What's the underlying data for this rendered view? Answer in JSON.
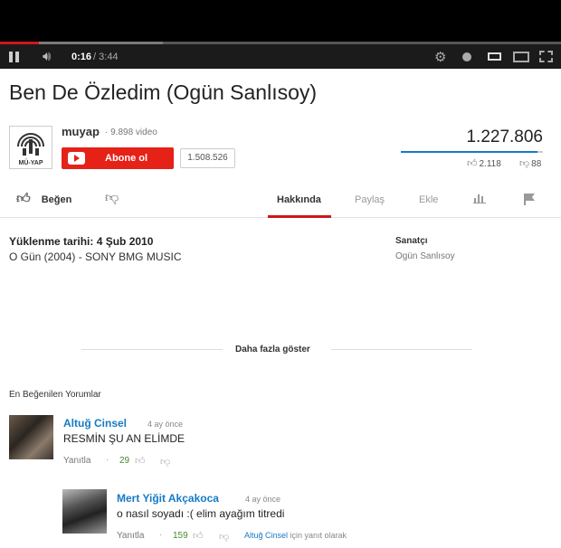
{
  "player": {
    "current_time": "0:16",
    "duration": "/ 3:44",
    "progress_fraction": 0.07,
    "buffered_fraction": 0.29
  },
  "video": {
    "title": "Ben De Özledim (Ogün Sanlısoy)",
    "views": "1.227.806",
    "likes": "2.118",
    "dislikes": "88",
    "like_ratio": 0.96
  },
  "channel": {
    "logo_text": "MÜ-YAP",
    "name": "muyap",
    "video_count": "· 9.898 video",
    "subscribe_label": "Abone ol",
    "subscriber_count": "1.508.526"
  },
  "actions": {
    "like_label": "Beğen",
    "tabs": [
      "Hakkında",
      "Paylaş",
      "Ekle"
    ]
  },
  "description": {
    "upload_date": "Yüklenme tarihi: 4 Şub 2010",
    "text": "O Gün (2004) - SONY BMG MUSIC",
    "artist_label": "Sanatçı",
    "artist_value": "Ogün Sanlısoy",
    "show_more": "Daha fazla göster"
  },
  "comments": {
    "heading": "En Beğenilen Yorumlar",
    "items": [
      {
        "author": "Altuğ Cinsel",
        "time": "4 ay önce",
        "text": "RESMİN ŞU AN ELİMDE",
        "reply": "Yanıtla",
        "likes": "29"
      },
      {
        "author": "Mert Yiğit Akçakoca",
        "time": "4 ay önce",
        "text": "o nasıl soyadı :( elim ayağım titredi",
        "reply": "Yanıtla",
        "likes": "159",
        "reply_to": "Altuğ Cinsel",
        "reply_to_suffix": " için yanıt olarak"
      }
    ]
  },
  "colors": {
    "accent_red": "#cc181e",
    "subscribe_red": "#e62117",
    "link_blue": "#167ac6"
  }
}
